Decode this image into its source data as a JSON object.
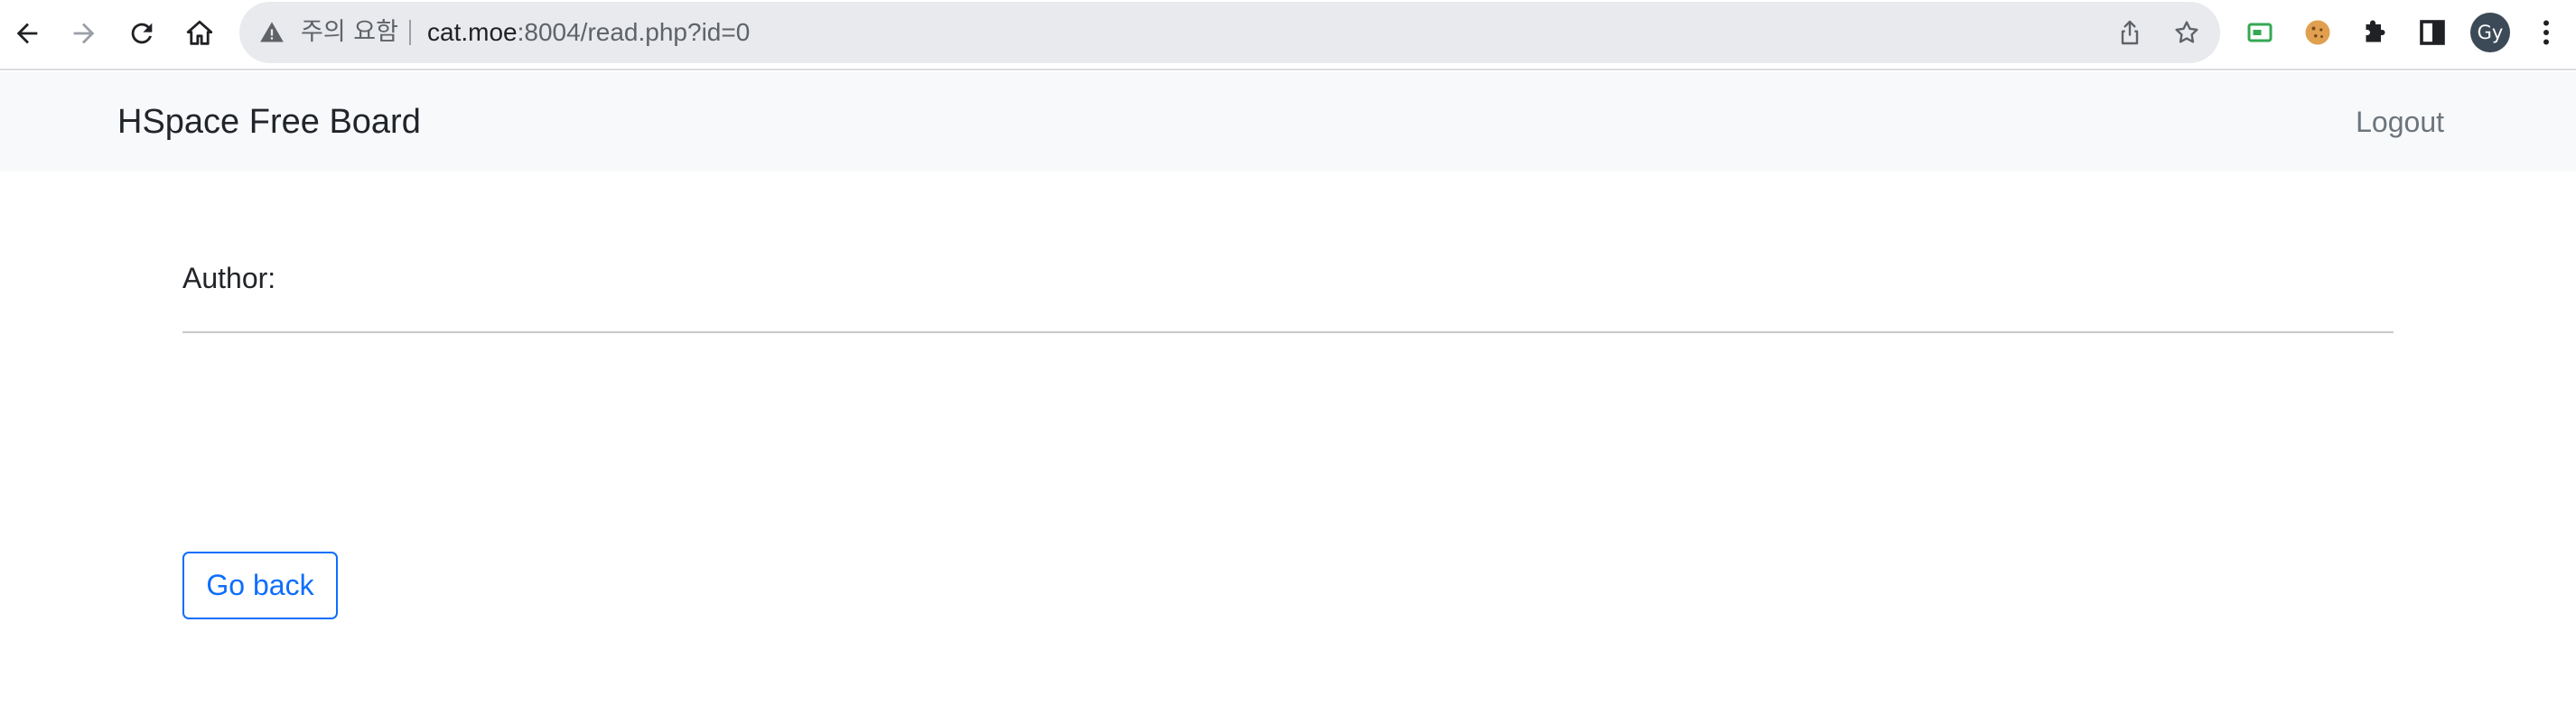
{
  "browser": {
    "security_label": "주의 요함",
    "url_host": "cat.moe",
    "url_rest": ":8004/read.php?id=0",
    "avatar_initials": "Gy",
    "icons": {
      "back": "arrow-left-icon",
      "forward": "arrow-right-icon",
      "reload": "reload-icon",
      "home": "home-icon",
      "warning": "warning-icon",
      "share": "share-icon",
      "bookmark": "star-icon",
      "extension_1": "screen-extension-icon",
      "extension_2": "cookie-icon",
      "extensions": "puzzle-icon",
      "side_panel": "side-panel-icon",
      "menu": "kebab-menu-icon"
    }
  },
  "navbar": {
    "brand": "HSpace Free Board",
    "logout": "Logout"
  },
  "post": {
    "author_label": "Author:",
    "author_value": "",
    "body": ""
  },
  "actions": {
    "go_back": "Go back"
  },
  "colors": {
    "accent": "#0d6efd",
    "navbar_bg": "#f8f9fa",
    "muted_text": "#6c757d",
    "omnibox_bg": "#e8eaed"
  }
}
